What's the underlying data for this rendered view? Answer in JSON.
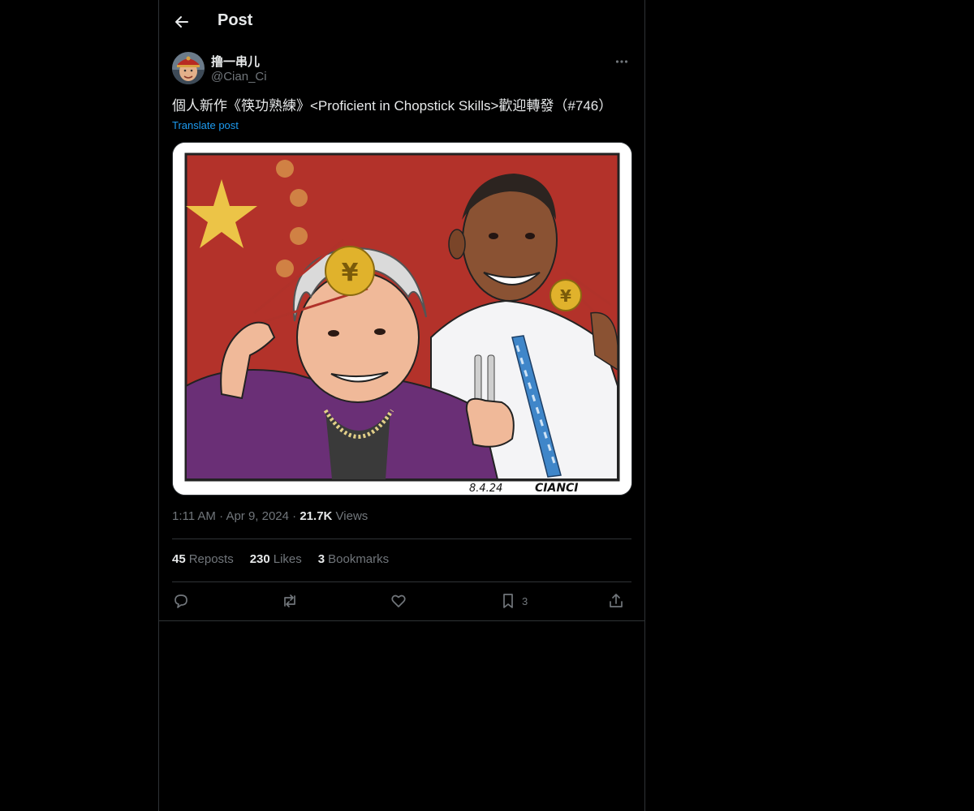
{
  "header": {
    "title": "Post",
    "back_icon": "arrow-left-icon"
  },
  "post": {
    "author": {
      "display_name": "撸一串儿",
      "handle": "@Cian_Ci",
      "avatar_icon": "avatar-portrait"
    },
    "more_icon": "ellipsis-icon",
    "text": "個人新作《筷功熟練》<Proficient in Chopstick Skills>歡迎轉發（#746）",
    "translate_label": "Translate post",
    "media": {
      "signature_date": "8.4.24",
      "signature_artist": "CIANCI",
      "flag_colors": {
        "field": "#b3322a",
        "star": "#f2d44a"
      }
    },
    "meta": {
      "time": "1:11 AM",
      "separator": "·",
      "date": "Apr 9, 2024",
      "views_count": "21.7K",
      "views_label": "Views"
    },
    "stats": [
      {
        "count": "45",
        "label": "Reposts"
      },
      {
        "count": "230",
        "label": "Likes"
      },
      {
        "count": "3",
        "label": "Bookmarks"
      }
    ],
    "actions": {
      "reply_icon": "reply-icon",
      "repost_icon": "repost-icon",
      "like_icon": "heart-icon",
      "bookmark_icon": "bookmark-icon",
      "bookmark_count": "3",
      "share_icon": "share-icon"
    }
  },
  "colors": {
    "background": "#000000",
    "text": "#e7e9ea",
    "muted": "#71767b",
    "link": "#1d9bf0",
    "border": "#2f3336"
  }
}
